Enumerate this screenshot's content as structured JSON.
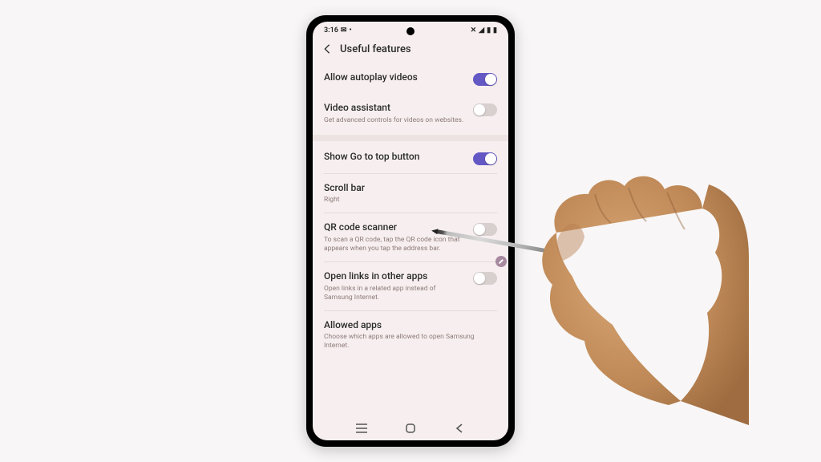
{
  "status": {
    "time": "3:16",
    "msg_icon": "msg-icon"
  },
  "header": {
    "title": "Useful features"
  },
  "items": [
    {
      "title": "Allow autoplay videos",
      "sub": "",
      "toggle": "on"
    },
    {
      "title": "Video assistant",
      "sub": "Get advanced controls for videos on websites.",
      "toggle": "off"
    },
    {
      "title": "Show Go to top button",
      "sub": "",
      "toggle": "on",
      "divider_before": true
    },
    {
      "title": "Scroll bar",
      "sub": "Right",
      "toggle": null
    },
    {
      "title": "QR code scanner",
      "sub": "To scan a QR code, tap the QR code icon that appears when you tap the address bar.",
      "toggle": "off"
    },
    {
      "title": "Open links in other apps",
      "sub": "Open links in a related app instead of Samsung Internet.",
      "toggle": "off"
    },
    {
      "title": "Allowed apps",
      "sub": "Choose which apps are allowed to open Samsung Internet.",
      "toggle": null
    }
  ],
  "colors": {
    "accent": "#6458c4"
  }
}
